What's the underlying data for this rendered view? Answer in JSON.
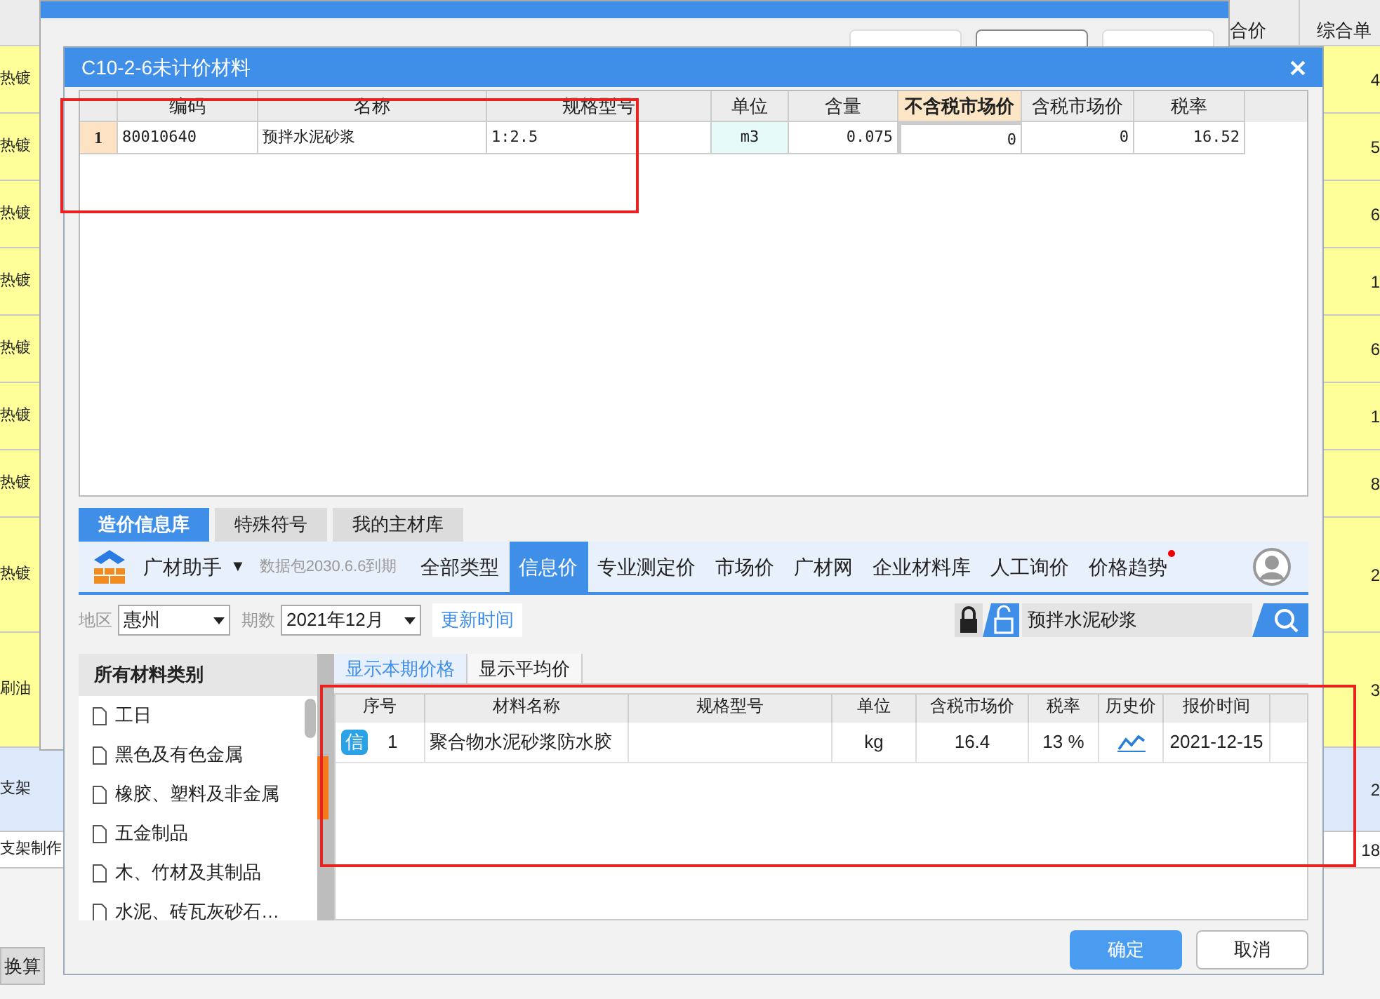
{
  "background": {
    "columns": [
      "合价",
      "综合单"
    ],
    "rows": [
      {
        "label": "热镀",
        "value": "4",
        "kind": "yellow"
      },
      {
        "label": "热镀",
        "value": "5",
        "kind": "yellow"
      },
      {
        "label": "热镀",
        "value": "6",
        "kind": "yellow"
      },
      {
        "label": "热镀",
        "value": "1",
        "kind": "yellow"
      },
      {
        "label": "热镀",
        "value": "6",
        "kind": "yellow"
      },
      {
        "label": "热镀",
        "value": "1",
        "kind": "yellow"
      },
      {
        "label": "热镀",
        "value": "8",
        "kind": "yellow"
      },
      {
        "label": "热镀",
        "value": "2",
        "kind": "tall"
      },
      {
        "label": "刷油",
        "value": "3",
        "kind": "tall"
      },
      {
        "label": "支架",
        "value": "2",
        "kind": "blue"
      },
      {
        "label": "支架制作",
        "value": "18",
        "kind": "white"
      }
    ],
    "bottom_tab": "换算"
  },
  "query_window": {
    "buttons": [
      {
        "enabled": false
      },
      {
        "enabled": true
      },
      {
        "enabled": false
      }
    ]
  },
  "dialog": {
    "title": "C10-2-6未计价材料",
    "table": {
      "columns": [
        {
          "label": "编码",
          "highlight": false
        },
        {
          "label": "名称",
          "highlight": false
        },
        {
          "label": "规格型号",
          "highlight": false
        },
        {
          "label": "单位",
          "highlight": false
        },
        {
          "label": "含量",
          "highlight": false
        },
        {
          "label": "不含税市场价",
          "highlight": true
        },
        {
          "label": "含税市场价",
          "highlight": false
        },
        {
          "label": "税率",
          "highlight": false
        }
      ],
      "rows": [
        {
          "index": "1",
          "cells": [
            "80010640",
            "预拌水泥砂浆",
            "1:2.5",
            "m3",
            "0.075",
            "0",
            "0",
            "16.52"
          ]
        }
      ]
    },
    "tabs": [
      {
        "label": "造价信息库",
        "selected": true
      },
      {
        "label": "特殊符号",
        "selected": false
      },
      {
        "label": "我的主材库",
        "selected": false
      }
    ],
    "assistant": {
      "name": "广材助手",
      "caret": "▼",
      "package": "数据包2030.6.6到期",
      "nav": [
        {
          "label": "全部类型",
          "selected": false,
          "dot": false
        },
        {
          "label": "信息价",
          "selected": true,
          "dot": false
        },
        {
          "label": "专业测定价",
          "selected": false,
          "dot": false
        },
        {
          "label": "市场价",
          "selected": false,
          "dot": false
        },
        {
          "label": "广材网",
          "selected": false,
          "dot": false
        },
        {
          "label": "企业材料库",
          "selected": false,
          "dot": false
        },
        {
          "label": "人工询价",
          "selected": false,
          "dot": false
        },
        {
          "label": "价格趋势",
          "selected": false,
          "dot": true
        }
      ]
    },
    "filters": {
      "region_label": "地区",
      "region": "惠州",
      "period_label": "期数",
      "period": "2021年12月",
      "update_button": "更新时间",
      "search": "预拌水泥砂浆"
    },
    "categories": {
      "title": "所有材料类别",
      "items": [
        "工日",
        "黑色及有色金属",
        "橡胶、塑料及非金属",
        "五金制品",
        "木、竹材及其制品",
        "水泥、砖瓦灰砂石…"
      ]
    },
    "price_tabs": [
      {
        "label": "显示本期价格",
        "selected": true
      },
      {
        "label": "显示平均价",
        "selected": false
      }
    ],
    "price_table": {
      "columns": [
        "序号",
        "材料名称",
        "规格型号",
        "单位",
        "含税市场价",
        "税率",
        "历史价",
        "报价时间"
      ],
      "rows": [
        {
          "badge": "信",
          "index": "1",
          "name": "聚合物水泥砂浆防水胶",
          "unit": "kg",
          "price": "16.4",
          "tax": "13 %",
          "date": "2021-12-15"
        }
      ]
    },
    "buttons": [
      {
        "label": "确定",
        "primary": true
      },
      {
        "label": "取消",
        "primary": false
      }
    ]
  }
}
